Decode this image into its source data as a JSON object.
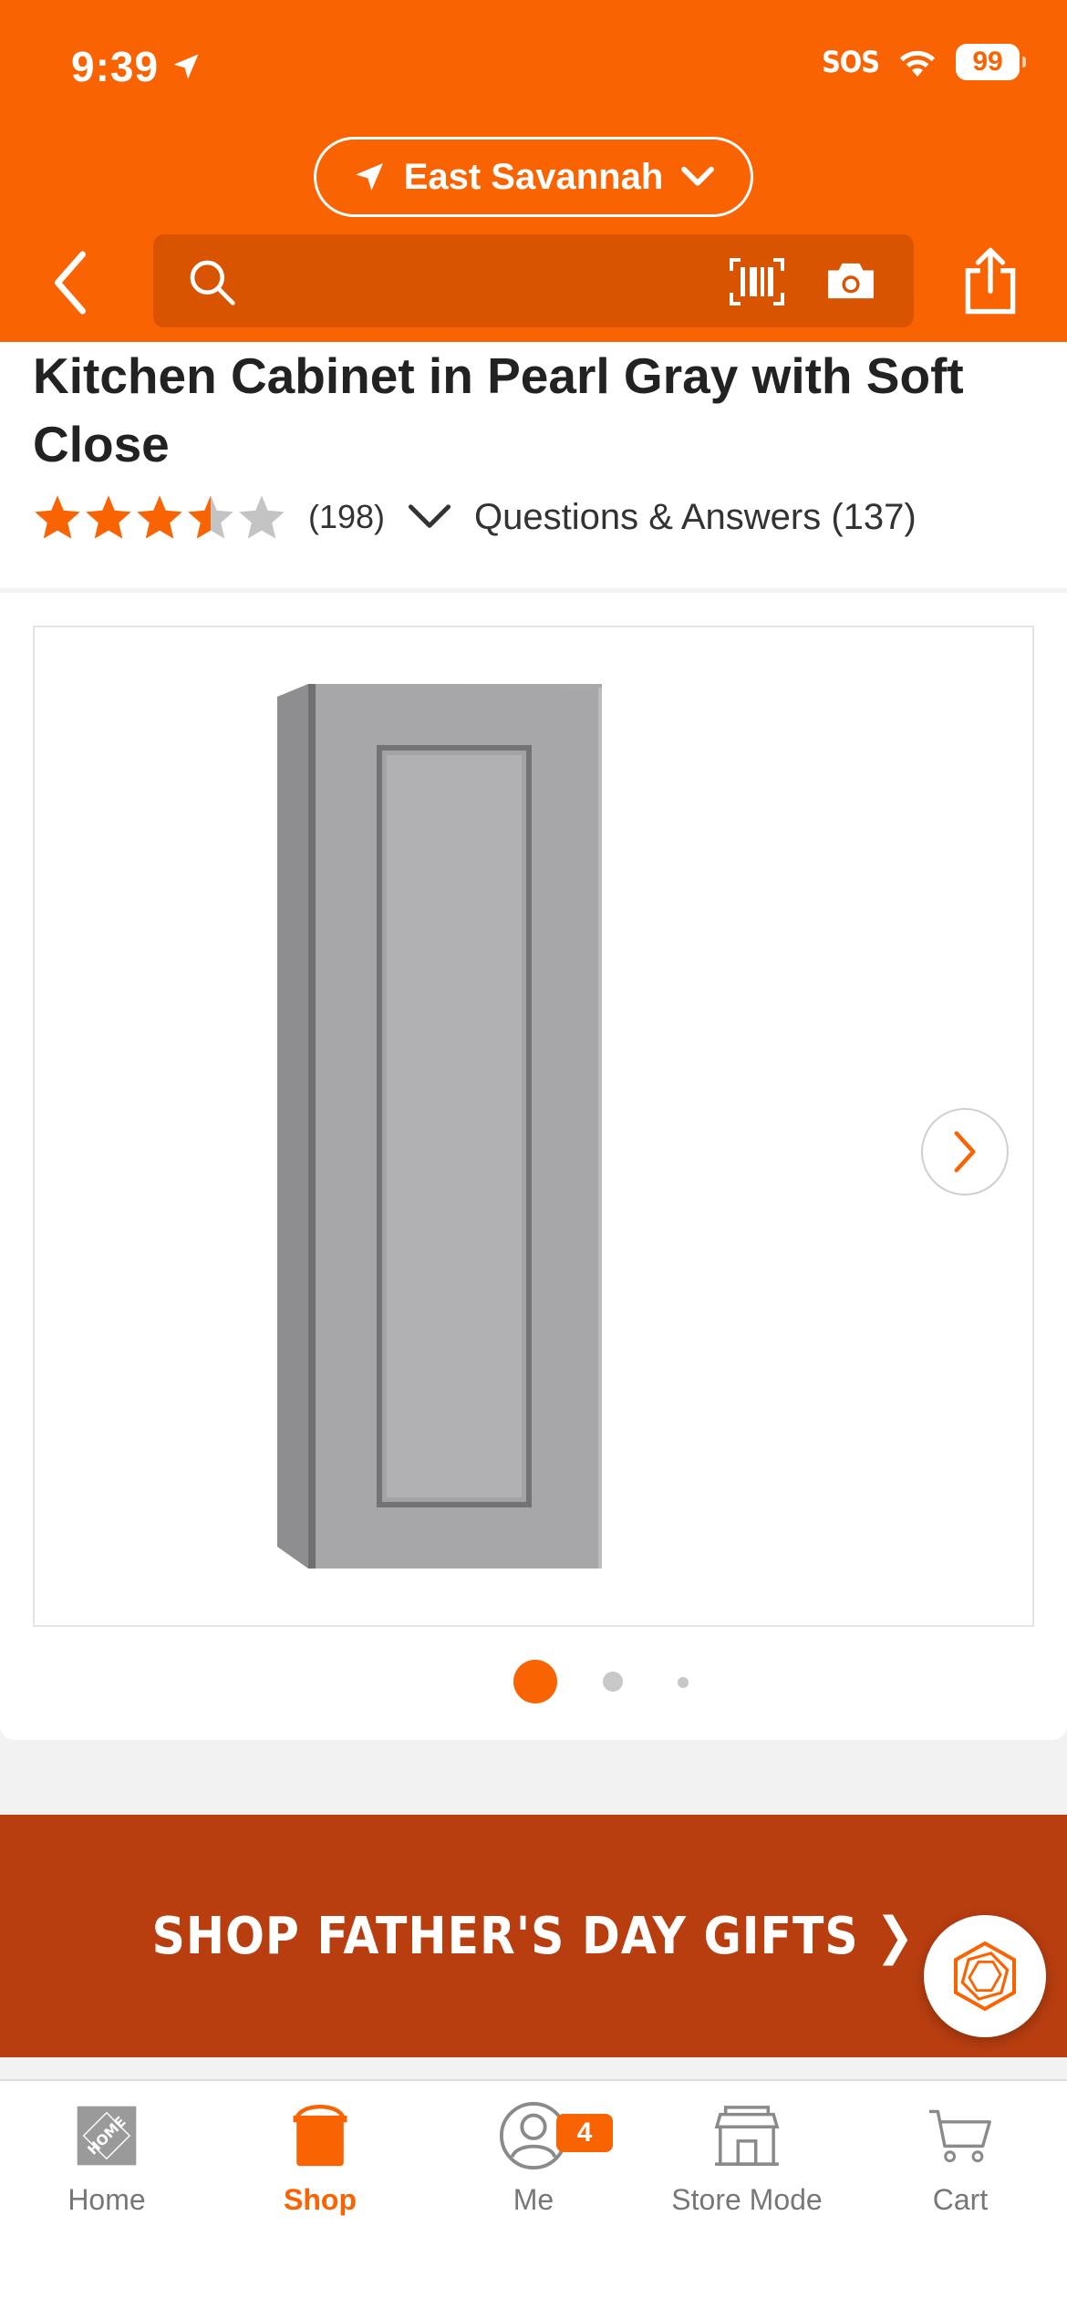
{
  "status_bar": {
    "time": "9:39",
    "sos": "SOS",
    "battery": "99"
  },
  "header": {
    "location": "East Savannah",
    "search_placeholder": ""
  },
  "product": {
    "title": "Kitchen Cabinet in Pearl Gray with Soft Close",
    "rating": 3.5,
    "review_count": "(198)",
    "qa_label": "Questions & Answers (137)"
  },
  "gallery": {
    "image_count": 3,
    "active_index": 0
  },
  "promo": {
    "label": "SHOP FATHER'S DAY GIFTS ❯"
  },
  "tabbar": {
    "items": [
      {
        "label": "Home",
        "icon": "home-depot-logo-icon"
      },
      {
        "label": "Shop",
        "icon": "shop-bucket-icon"
      },
      {
        "label": "Me",
        "icon": "user-icon",
        "badge": "4"
      },
      {
        "label": "Store Mode",
        "icon": "store-icon"
      },
      {
        "label": "Cart",
        "icon": "cart-icon"
      }
    ],
    "active": "Shop"
  },
  "colors": {
    "brand": "#f96302",
    "promo": "#b83e10",
    "search": "#d95400"
  }
}
